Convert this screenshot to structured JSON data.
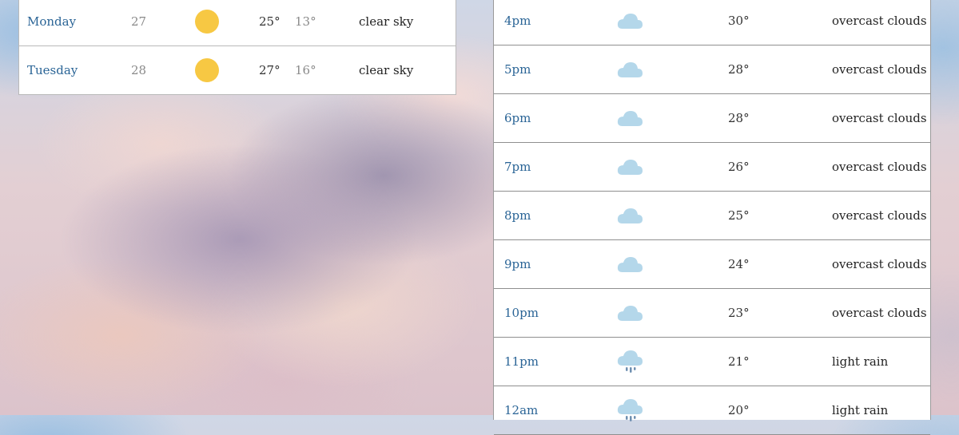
{
  "daily": [
    {
      "day": "Monday",
      "date": "27",
      "icon": "sun-icon",
      "high": "25°",
      "low": "13°",
      "description": "clear sky"
    },
    {
      "day": "Tuesday",
      "date": "28",
      "icon": "sun-icon",
      "high": "27°",
      "low": "16°",
      "description": "clear sky"
    }
  ],
  "hourly": [
    {
      "time": "4pm",
      "icon": "cloud-icon",
      "temp": "30°",
      "description": "overcast clouds"
    },
    {
      "time": "5pm",
      "icon": "cloud-icon",
      "temp": "28°",
      "description": "overcast clouds"
    },
    {
      "time": "6pm",
      "icon": "cloud-icon",
      "temp": "28°",
      "description": "overcast clouds"
    },
    {
      "time": "7pm",
      "icon": "cloud-icon",
      "temp": "26°",
      "description": "overcast clouds"
    },
    {
      "time": "8pm",
      "icon": "cloud-icon",
      "temp": "25°",
      "description": "overcast clouds"
    },
    {
      "time": "9pm",
      "icon": "cloud-icon",
      "temp": "24°",
      "description": "overcast clouds"
    },
    {
      "time": "10pm",
      "icon": "cloud-icon",
      "temp": "23°",
      "description": "overcast clouds"
    },
    {
      "time": "11pm",
      "icon": "rain-cloud-icon",
      "temp": "21°",
      "description": "light rain"
    },
    {
      "time": "12am",
      "icon": "rain-cloud-icon",
      "temp": "20°",
      "description": "light rain"
    }
  ],
  "colors": {
    "sun": "#f7c843",
    "cloud": "#b4d7ea",
    "rain": "#6e8fb0",
    "link": "#2a6496"
  }
}
